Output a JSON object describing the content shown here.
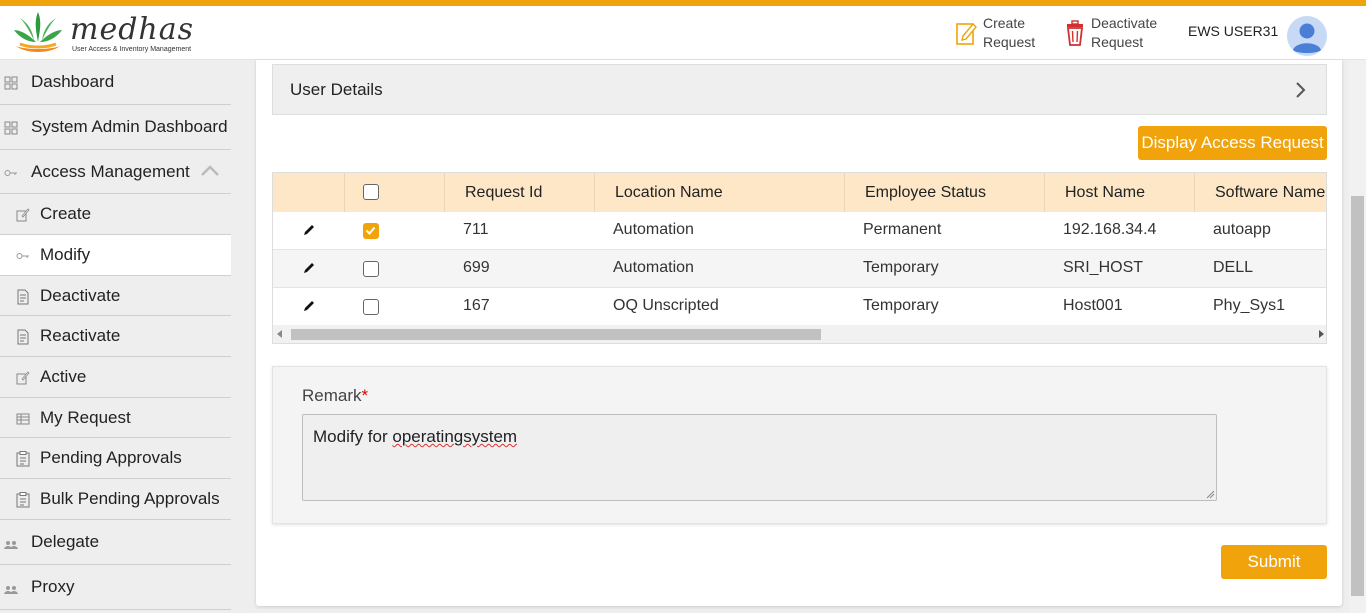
{
  "app": {
    "logo_text": "medhas",
    "logo_subtitle": "User Access & Inventory Management",
    "accent_color": "#f0a30a"
  },
  "header": {
    "create_request": [
      "Create",
      "Request"
    ],
    "deactivate_request": [
      "Deactivate",
      "Request"
    ],
    "user_name": "EWS USER31"
  },
  "sidebar": {
    "items": [
      {
        "label": "Dashboard",
        "icon": "grid-icon"
      },
      {
        "label": "System Admin Dashboard",
        "icon": "grid-icon"
      },
      {
        "label": "Access Management",
        "icon": "key-icon",
        "expanded": true
      },
      {
        "label": "Create",
        "icon": "edit-icon"
      },
      {
        "label": "Modify",
        "icon": "key-icon",
        "active": true
      },
      {
        "label": "Deactivate",
        "icon": "document-icon"
      },
      {
        "label": "Reactivate",
        "icon": "document-icon"
      },
      {
        "label": "Active",
        "icon": "edit-icon"
      },
      {
        "label": "My Request",
        "icon": "table-icon"
      },
      {
        "label": "Pending Approvals",
        "icon": "clipboard-icon"
      },
      {
        "label": "Bulk Pending Approvals",
        "icon": "clipboard-icon"
      },
      {
        "label": "Delegate",
        "icon": "people-icon"
      },
      {
        "label": "Proxy",
        "icon": "people-icon"
      }
    ]
  },
  "main": {
    "user_details_label": "User Details",
    "display_button": "Display Access Request",
    "table": {
      "columns": [
        "Request Id",
        "Location Name",
        "Employee Status",
        "Host Name",
        "Software Name"
      ],
      "rows": [
        {
          "checked": true,
          "cells": [
            "711",
            "Automation",
            "Permanent",
            "192.168.34.4",
            "autoapp"
          ]
        },
        {
          "checked": false,
          "cells": [
            "699",
            "Automation",
            "Temporary",
            "SRI_HOST",
            "DELL"
          ]
        },
        {
          "checked": false,
          "cells": [
            "167",
            "OQ Unscripted",
            "Temporary",
            "Host001",
            "Phy_Sys1"
          ]
        }
      ]
    },
    "remark": {
      "label": "Remark",
      "required_mark": "*",
      "value_prefix": "Modify for ",
      "value_word": "operatingsystem"
    },
    "submit_button": "Submit"
  }
}
